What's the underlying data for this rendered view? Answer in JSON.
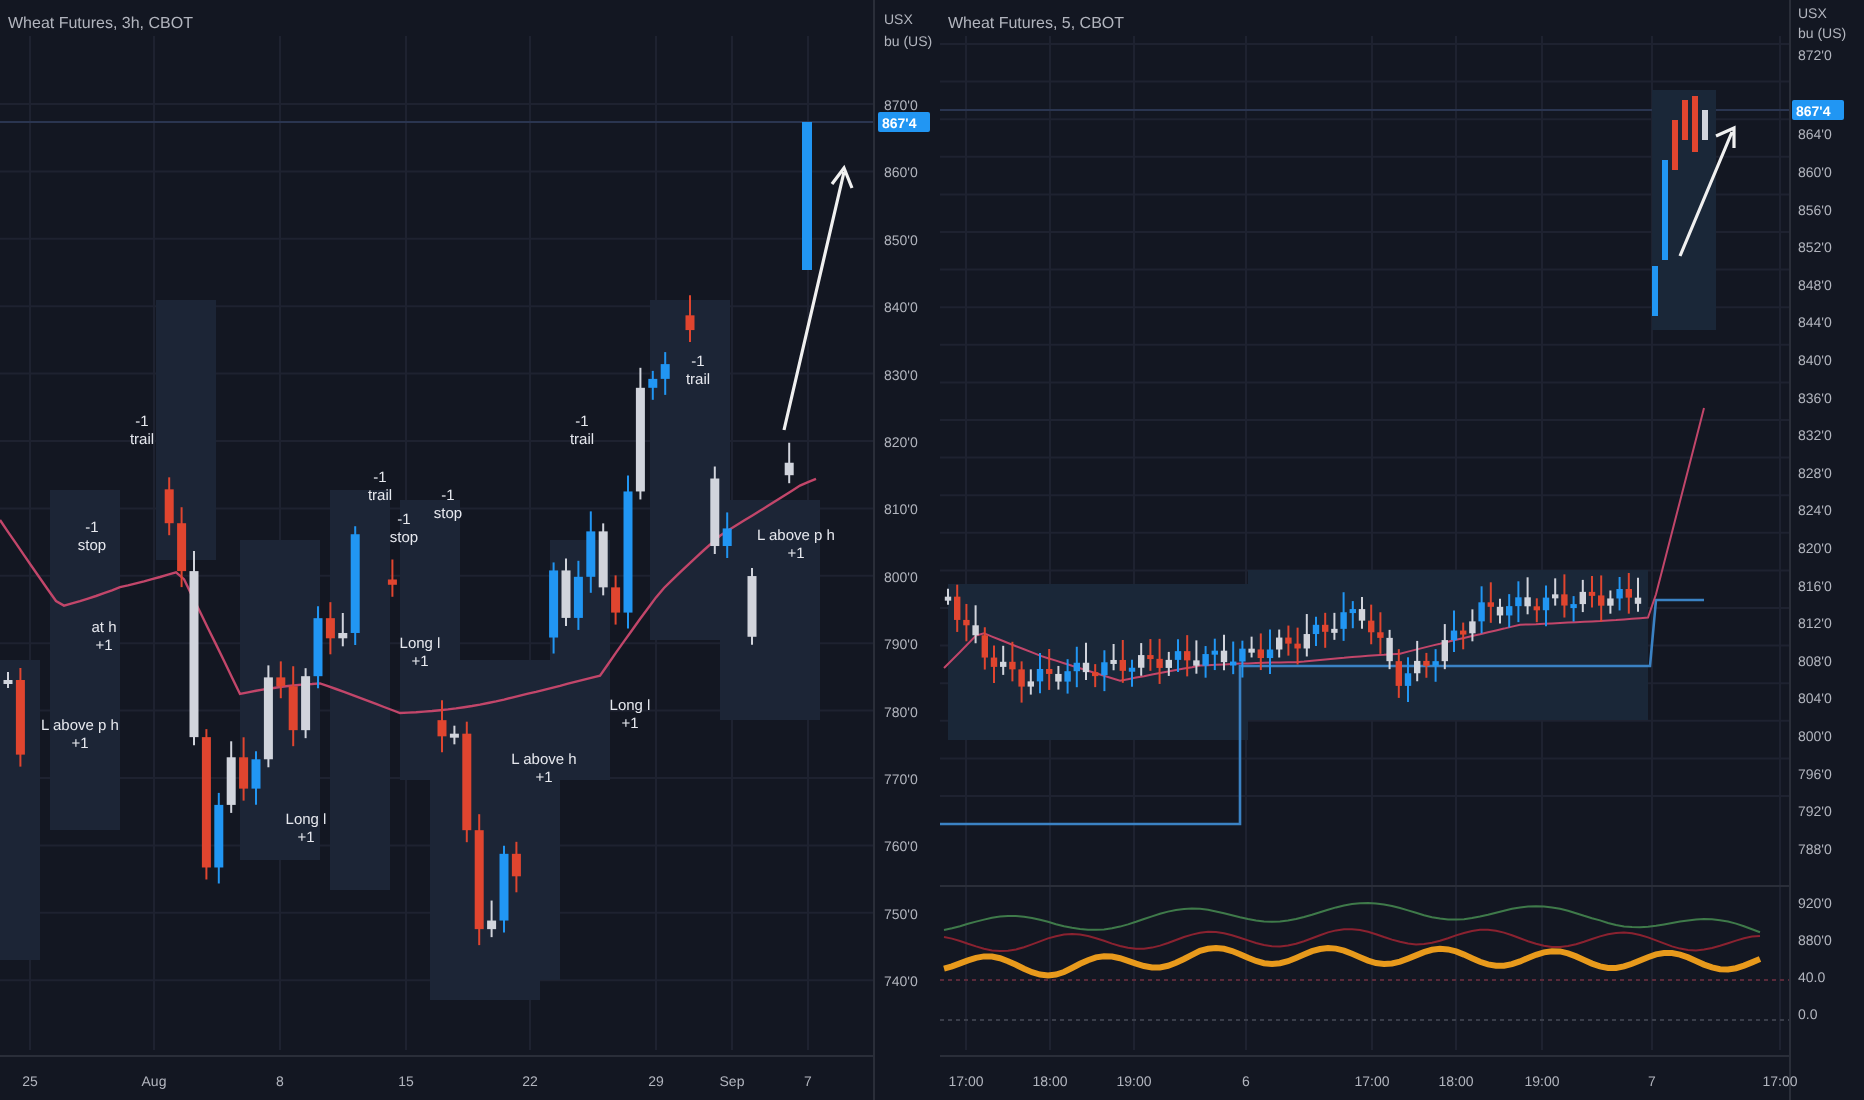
{
  "left_chart": {
    "title": "Wheat Futures, 3h, CBOT",
    "currency": "USX",
    "unit": "bu (US)",
    "last_price": "867'4",
    "price_axis": [
      "870'0",
      "860'0",
      "850'0",
      "840'0",
      "830'0",
      "820'0",
      "810'0",
      "800'0",
      "790'0",
      "780'0",
      "770'0",
      "760'0",
      "750'0",
      "740'0"
    ],
    "time_axis": [
      "25",
      "Aug",
      "8",
      "15",
      "22",
      "29",
      "Sep",
      "7"
    ],
    "annotations": [
      {
        "lines": [
          "-1",
          "trail"
        ]
      },
      {
        "lines": [
          "-1",
          "stop"
        ]
      },
      {
        "lines": [
          "at h",
          "+1"
        ]
      },
      {
        "lines": [
          "L above p h",
          "+1"
        ]
      },
      {
        "lines": [
          "Long l",
          "+1"
        ]
      },
      {
        "lines": [
          "-1",
          "trail"
        ]
      },
      {
        "lines": [
          "-1",
          "stop"
        ]
      },
      {
        "lines": [
          "-1",
          "stop"
        ]
      },
      {
        "lines": [
          "Long l",
          "+1"
        ]
      },
      {
        "lines": [
          "L above h",
          "+1"
        ]
      },
      {
        "lines": [
          "-1",
          "trail"
        ]
      },
      {
        "lines": [
          "Long l",
          "+1"
        ]
      },
      {
        "lines": [
          "-1",
          "trail"
        ]
      },
      {
        "lines": [
          "L above p h",
          "+1"
        ]
      }
    ]
  },
  "right_chart": {
    "title": "Wheat Futures, 5, CBOT",
    "currency": "USX",
    "unit": "bu (US)",
    "last_price": "867'4",
    "price_axis": [
      "872'0",
      "864'0",
      "860'0",
      "856'0",
      "852'0",
      "848'0",
      "844'0",
      "840'0",
      "836'0",
      "832'0",
      "828'0",
      "824'0",
      "820'0",
      "816'0",
      "812'0",
      "808'0",
      "804'0",
      "800'0",
      "796'0",
      "792'0",
      "788'0"
    ],
    "indicator_axis": [
      "920'0",
      "880'0",
      "40.0",
      "0.0"
    ],
    "time_axis": [
      "17:00",
      "18:00",
      "19:00",
      "6",
      "17:00",
      "18:00",
      "19:00",
      "7",
      "17:00"
    ]
  }
}
